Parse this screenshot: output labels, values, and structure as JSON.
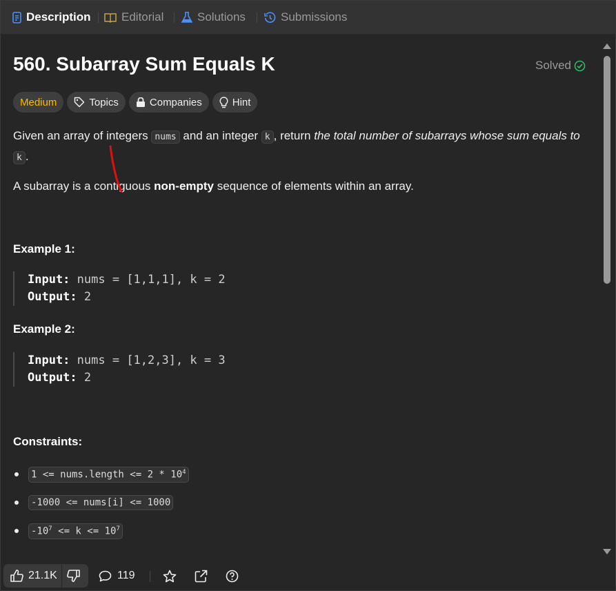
{
  "tabs": {
    "description": "Description",
    "editorial": "Editorial",
    "solutions": "Solutions",
    "submissions": "Submissions"
  },
  "problem": {
    "title": "560. Subarray Sum Equals K",
    "status": "Solved",
    "difficulty": "Medium",
    "chips": {
      "topics": "Topics",
      "companies": "Companies",
      "hint": "Hint"
    },
    "desc_1a": "Given an array of integers ",
    "desc_code_nums": "nums",
    "desc_1b": " and an integer ",
    "desc_code_k": "k",
    "desc_1c": ", return ",
    "desc_1_em": "the total number of subarrays whose sum equals to",
    "desc_code_k2": "k",
    "desc_1d": ".",
    "desc_2a": "A subarray is a contiguous ",
    "desc_2_bold": "non-empty",
    "desc_2b": " sequence of elements within an array."
  },
  "examples": [
    {
      "heading": "Example 1:",
      "input_label": "Input:",
      "input": "nums = [1,1,1], k = 2",
      "output_label": "Output:",
      "output": "2"
    },
    {
      "heading": "Example 2:",
      "input_label": "Input:",
      "input": "nums = [1,2,3], k = 3",
      "output_label": "Output:",
      "output": "2"
    }
  ],
  "constraints": {
    "heading": "Constraints:",
    "c1_main": "1 <= nums.length <= 2 * 10",
    "c1_sup": "4",
    "c2": "-1000 <= nums[i] <= 1000",
    "c3_a": "-10",
    "c3_sup1": "7",
    "c3_b": " <= k <= 10",
    "c3_sup2": "7"
  },
  "footer": {
    "likes": "21.1K",
    "comments": "119"
  },
  "colors": {
    "accent_medium": "#ffb800",
    "solved_green": "#2cbb5d",
    "tab_icon_blue": "#4f8ff7",
    "editorial_icon": "#c8a24a",
    "annotation_red": "#e01010"
  },
  "icons": [
    "description-icon",
    "book-icon",
    "flask-icon",
    "history-icon",
    "check-circle-icon",
    "tag-icon",
    "lock-icon",
    "lightbulb-icon",
    "thumbs-up-icon",
    "thumbs-down-icon",
    "comment-icon",
    "star-icon",
    "share-icon",
    "help-icon"
  ]
}
